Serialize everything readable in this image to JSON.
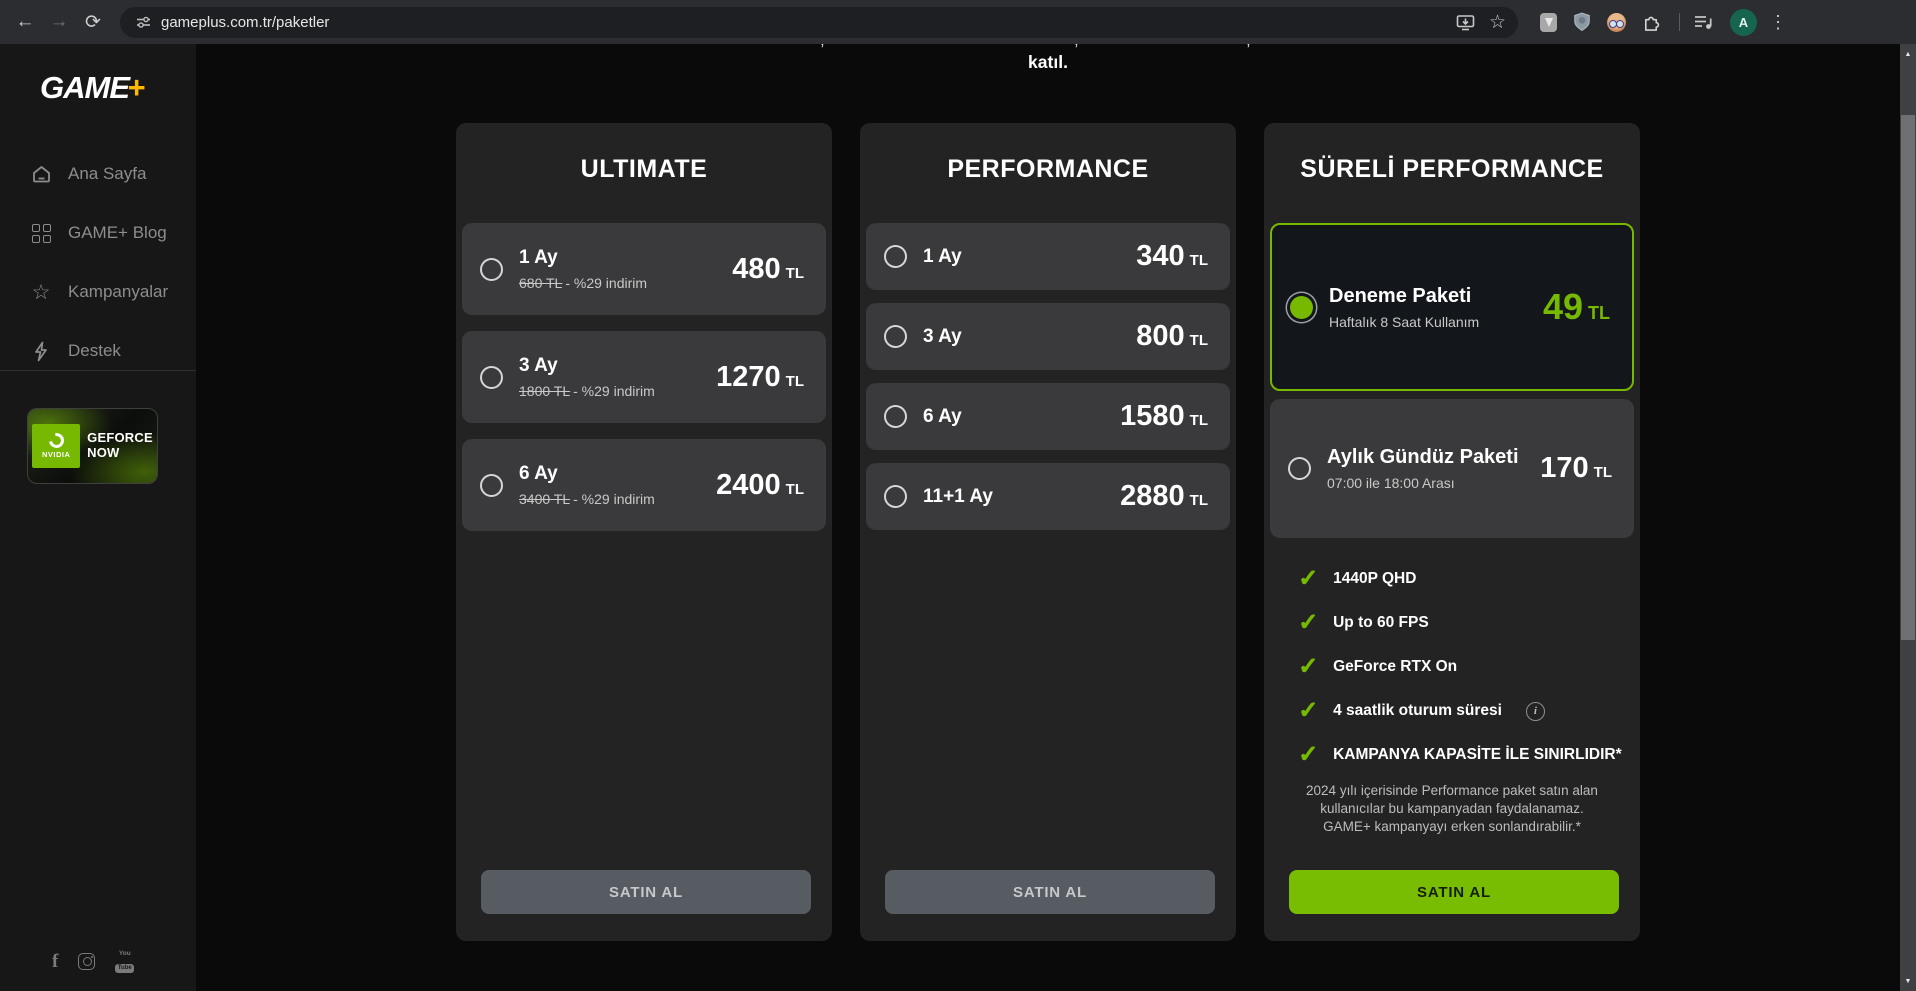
{
  "browser": {
    "url": "gameplus.com.tr/paketler",
    "avatar_letter": "A"
  },
  "glyphs": {
    "back": "←",
    "forward": "→",
    "reload": "⟳",
    "star": "☆",
    "nav_star": "☆",
    "menu": "⋮",
    "check": "✓",
    "info": "i",
    "up": "▲",
    "down": "▼",
    "facebook": "f",
    "youtube_top": "You",
    "youtube_bottom": "Tube"
  },
  "sidebar": {
    "logo_text": "GAME",
    "logo_plus": "+",
    "items": [
      {
        "label": "Ana Sayfa"
      },
      {
        "label": "GAME+ Blog"
      },
      {
        "label": "Kampanyalar"
      },
      {
        "label": "Destek"
      }
    ],
    "nvidia_badge": {
      "brand": "NVIDIA",
      "line1": "GEFORCE",
      "line2": "NOW"
    }
  },
  "page": {
    "intro_tail": "katıl.",
    "fragments": [
      ",",
      ",",
      ","
    ]
  },
  "cards": [
    {
      "title": "ULTIMATE",
      "options": [
        {
          "label": "1 Ay",
          "old_price": "680 TL",
          "discount": "- %29 indirim",
          "price": "480",
          "currency": "TL"
        },
        {
          "label": "3 Ay",
          "old_price": "1800 TL",
          "discount": "- %29 indirim",
          "price": "1270",
          "currency": "TL"
        },
        {
          "label": "6 Ay",
          "old_price": "3400 TL",
          "discount": "- %29 indirim",
          "price": "2400",
          "currency": "TL"
        }
      ],
      "buy_label": "SATIN AL"
    },
    {
      "title": "PERFORMANCE",
      "options": [
        {
          "label": "1 Ay",
          "price": "340",
          "currency": "TL"
        },
        {
          "label": "3 Ay",
          "price": "800",
          "currency": "TL"
        },
        {
          "label": "6 Ay",
          "price": "1580",
          "currency": "TL"
        },
        {
          "label": "11+1 Ay",
          "price": "2880",
          "currency": "TL"
        }
      ],
      "buy_label": "SATIN AL"
    },
    {
      "title": "SÜRELİ PERFORMANCE",
      "options": [
        {
          "label": "Deneme Paketi",
          "sub": "Haftalık 8 Saat Kullanım",
          "price": "49",
          "currency": "TL",
          "selected": true
        },
        {
          "label": "Aylık Gündüz Paketi",
          "sub": "07:00 ile 18:00 Arası",
          "price": "170",
          "currency": "TL"
        }
      ],
      "features": [
        {
          "text": "1440P QHD"
        },
        {
          "text": "Up to 60 FPS"
        },
        {
          "text": "GeForce RTX On"
        },
        {
          "text": "4 saatlik oturum süresi",
          "info": true
        },
        {
          "text": "KAMPANYA KAPASİTE İLE SINIRLIDIR*"
        }
      ],
      "footnote": "2024 yılı içerisinde Performance paket satın alan kullanıcılar bu kampanyadan faydalanamaz. GAME+ kampanyayı erken sonlandırabilir.*",
      "buy_label": "SATIN AL"
    }
  ],
  "colors": {
    "accent": "#76b900",
    "logo-yellow": "#ffb900",
    "btn-green": "#79bd02",
    "btn-gray": "#575c63"
  }
}
